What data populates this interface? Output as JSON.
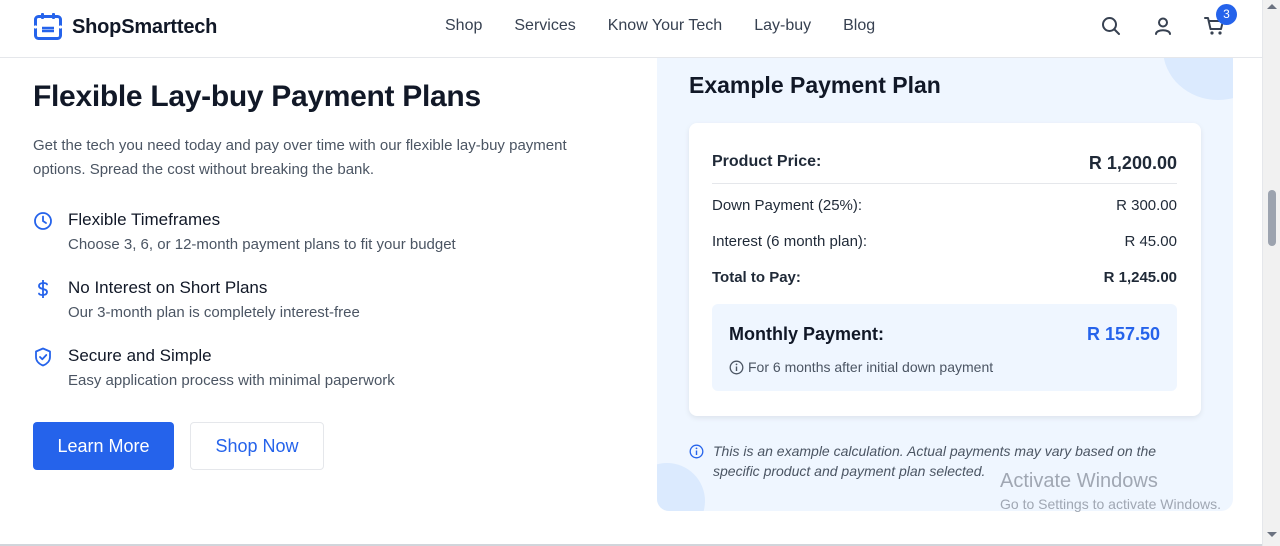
{
  "brand": {
    "name": "ShopSmarttech",
    "accent": "#2563eb"
  },
  "nav": [
    "Shop",
    "Services",
    "Know Your Tech",
    "Lay-buy",
    "Blog"
  ],
  "header": {
    "cart_count": "3",
    "icons": [
      "search-icon",
      "user-icon",
      "cart-icon"
    ]
  },
  "hero": {
    "title": "Flexible Lay-buy Payment Plans",
    "intro": "Get the tech you need today and pay over time with our flexible lay-buy payment options. Spread the cost without breaking the bank.",
    "features": [
      {
        "icon": "clock-icon",
        "title": "Flexible Timeframes",
        "desc": "Choose 3, 6, or 12-month payment plans to fit your budget"
      },
      {
        "icon": "dollar-icon",
        "title": "No Interest on Short Plans",
        "desc": "Our 3-month plan is completely interest-free"
      },
      {
        "icon": "shield-icon",
        "title": "Secure and Simple",
        "desc": "Easy application process with minimal paperwork"
      }
    ],
    "learn_more": "Learn More",
    "shop_now": "Shop Now"
  },
  "plan": {
    "title": "Example Payment Plan",
    "product_price_label": "Product Price:",
    "product_price": "R 1,200.00",
    "down_label": "Down Payment (25%):",
    "down_value": "R 300.00",
    "interest_label": "Interest (6 month plan):",
    "interest_value": "R 45.00",
    "total_label": "Total to Pay:",
    "total_value": "R 1,245.00",
    "monthly_label": "Monthly Payment:",
    "monthly_value": "R 157.50",
    "monthly_note": "For 6 months after initial down payment",
    "disclaimer": "This is an example calculation. Actual payments may vary based on the specific product and payment plan selected."
  },
  "watermark": {
    "line1": "Activate Windows",
    "line2": "Go to Settings to activate Windows."
  }
}
